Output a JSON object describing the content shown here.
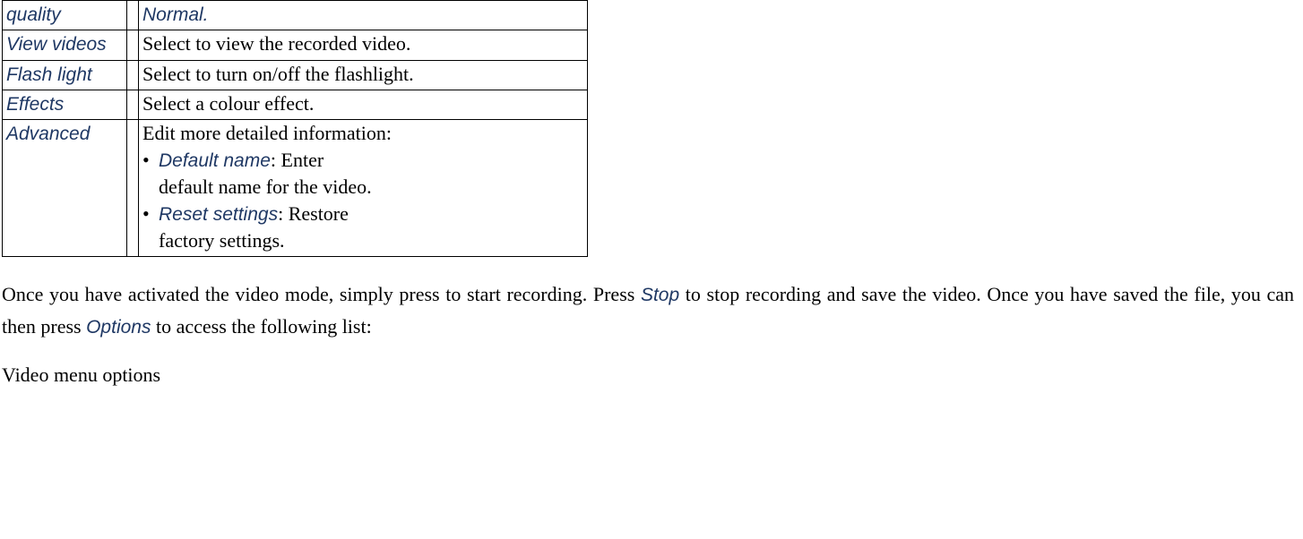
{
  "table": {
    "rows": [
      {
        "label": "quality",
        "value_term": "Normal."
      },
      {
        "label": "View videos",
        "value_plain": "Select to view the recorded video."
      },
      {
        "label": "Flash light",
        "value_plain": "Select to turn on/off the flashlight."
      },
      {
        "label": "Effects",
        "value_plain": "Select a colour effect."
      },
      {
        "label": "Advanced",
        "intro": "Edit more detailed information:",
        "bullets": [
          {
            "term": "Default name",
            "rest_first": ": Enter",
            "rest_cont": "default name for the video."
          },
          {
            "term": "Reset settings",
            "rest_first": ": Restore",
            "rest_cont": "factory settings."
          }
        ]
      }
    ]
  },
  "paragraph": {
    "p1a": "Once you have activated the video mode, simply press   to start recording. Press ",
    "stop": "Stop",
    "p1b": " to stop recording and save the video. Once you have saved the file, you can then press ",
    "options": "Options",
    "p1c": " to access the following list:"
  },
  "heading": "Video menu options"
}
